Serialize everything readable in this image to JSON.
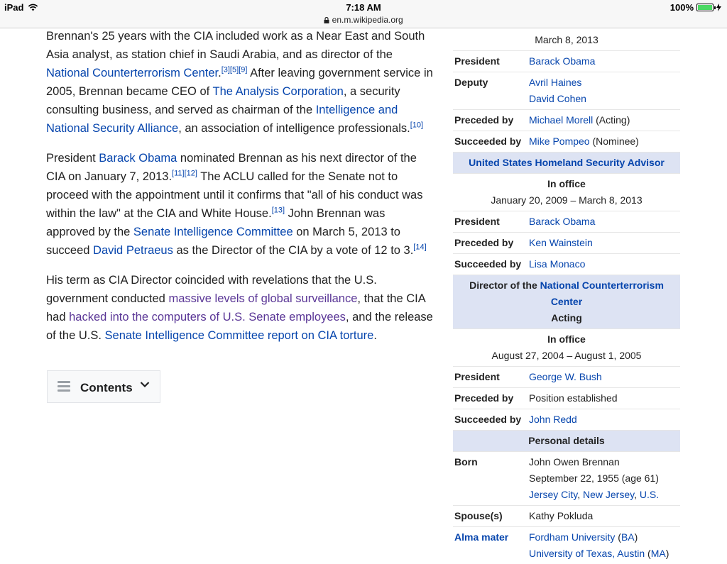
{
  "status": {
    "device": "iPad",
    "time": "7:18 AM",
    "battery": "100%",
    "url": "en.m.wikipedia.org"
  },
  "article": {
    "p1": {
      "t1": "Brennan's 25 years with the CIA included work as a Near East and South Asia analyst, as station chief in Saudi Arabia, and as director of the ",
      "l1": "National Counterterrorism Center",
      "r1": "[3][5][9]",
      "t2": " After leaving government service in 2005, Brennan became CEO of ",
      "l2": "The Analysis Corporation",
      "t3": ", a security consulting business, and served as chairman of the ",
      "l3": "Intelligence and National Security Alliance",
      "t4": ", an association of intelligence professionals.",
      "r2": "[10]"
    },
    "p2": {
      "t1": "President ",
      "l1": "Barack Obama",
      "t2": " nominated Brennan as his next director of the CIA on January 7, 2013.",
      "r1": "[11][12]",
      "t3": " The ACLU called for the Senate not to proceed with the appointment until it confirms that \"all of his conduct was within the law\" at the CIA and White House.",
      "r2": "[13]",
      "t4": " John Brennan was approved by the ",
      "l2": "Senate Intelligence Committee",
      "t5": " on March 5, 2013 to succeed ",
      "l3": "David Petraeus",
      "t6": " as the Director of the CIA by a vote of 12 to 3.",
      "r3": "[14]"
    },
    "p3": {
      "t1": "His term as CIA Director coincided with revelations that the U.S. government conducted ",
      "l1": "massive levels of global surveillance",
      "t2": ", that the CIA had ",
      "l2": "hacked into the computers of U.S. Senate employees",
      "t3": ", and the release of the U.S. ",
      "l3": "Senate Intelligence Committee report on CIA torture",
      "t4": "."
    },
    "contents_label": "Contents"
  },
  "infobox": {
    "top_date": "March 8, 2013",
    "cia": {
      "president_label": "President",
      "president": "Barack Obama",
      "deputy_label": "Deputy",
      "deputy1": "Avril Haines",
      "deputy2": "David Cohen",
      "preceded_label": "Preceded by",
      "preceded": "Michael Morell",
      "preceded_note": " (Acting)",
      "succeeded_label": "Succeeded by",
      "succeeded": "Mike Pompeo",
      "succeeded_note": " (Nominee)"
    },
    "hsa": {
      "header": "United States Homeland Security Advisor",
      "in_office": "In office",
      "dates": "January 20, 2009 – March 8, 2013",
      "president_label": "President",
      "president": "Barack Obama",
      "preceded_label": "Preceded by",
      "preceded": "Ken Wainstein",
      "succeeded_label": "Succeeded by",
      "succeeded": "Lisa Monaco"
    },
    "nctc": {
      "header_prefix": "Director of the ",
      "header_link": "National Counterterrorism Center",
      "acting": "Acting",
      "in_office": "In office",
      "dates": "August 27, 2004 – August 1, 2005",
      "president_label": "President",
      "president": "George W. Bush",
      "preceded_label": "Preceded by",
      "preceded": "Position established",
      "succeeded_label": "Succeeded by",
      "succeeded": "John Redd"
    },
    "personal": {
      "header": "Personal details",
      "born_label": "Born",
      "born_name": "John Owen Brennan",
      "born_date": "September 22, 1955 (age 61)",
      "born_city": "Jersey City",
      "born_state": "New Jersey",
      "born_country": "U.S.",
      "spouse_label": "Spouse(s)",
      "spouse": "Kathy Pokluda",
      "alma_label": "Alma mater",
      "alma1": "Fordham University",
      "alma1_deg": "BA",
      "alma2": "University of Texas, Austin",
      "alma2_deg": "MA"
    }
  },
  "colors": {
    "link": "#0645ad",
    "visited": "#5a3696",
    "header_bg": "#dde3f3"
  },
  "icons": {
    "wifi": "wifi-icon",
    "battery": "battery-icon",
    "lock": "lock-icon",
    "menu": "hamburger-icon",
    "chevron": "chevron-down-icon"
  }
}
